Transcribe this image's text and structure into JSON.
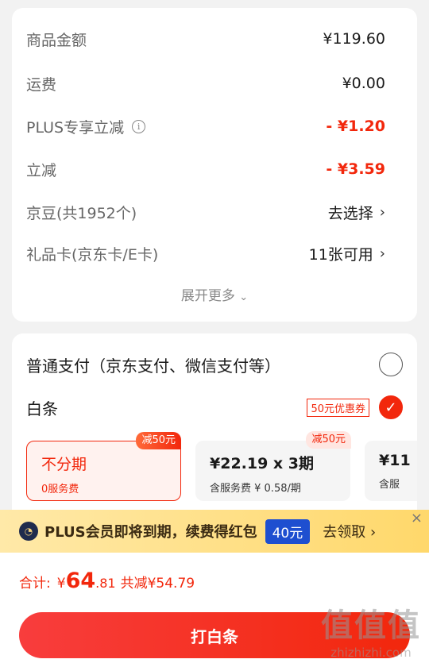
{
  "summary": {
    "rows": [
      {
        "label": "商品金额",
        "value": "¥119.60"
      },
      {
        "label": "运费",
        "value": "¥0.00"
      },
      {
        "label": "PLUS专享立减",
        "value": "- ¥1.20"
      },
      {
        "label": "立减",
        "value": "- ¥3.59"
      },
      {
        "label": "京豆(共1952个)",
        "value": "去选择"
      },
      {
        "label": "礼品卡(京东卡/E卡)",
        "value": "11张可用"
      }
    ],
    "expand_label": "展开更多",
    "info_glyph": "i",
    "chevron": "›"
  },
  "payment": {
    "normal_label": "普通支付（京东支付、微信支付等）",
    "baitiao_label": "白条",
    "coupon_badge": "50元优惠券",
    "check_glyph": "✓",
    "plans": [
      {
        "tag": "减50元",
        "main": "不分期",
        "sub": "0服务费"
      },
      {
        "tag": "减50元",
        "main": "¥22.19 x 3期",
        "sub": "含服务费 ¥ 0.58/期"
      },
      {
        "main": "¥11",
        "sub": "含服"
      }
    ]
  },
  "banner": {
    "badge": "◔",
    "text": "PLUS会员即将到期，续费得红包",
    "amount": "40元",
    "claim": "去领取 ›",
    "close": "×"
  },
  "footer": {
    "total_label": "合计:",
    "currency": "¥",
    "total_int": "64",
    "total_dec": ".81",
    "saved": "共减¥54.79",
    "cta": "打白条"
  },
  "watermark": {
    "big": "值值值",
    "small": "zhizhizhi.com"
  },
  "colors": {
    "accent": "#f2270c",
    "banner_bg": "#ffd86b",
    "amount_pill": "#1e4fd0"
  }
}
